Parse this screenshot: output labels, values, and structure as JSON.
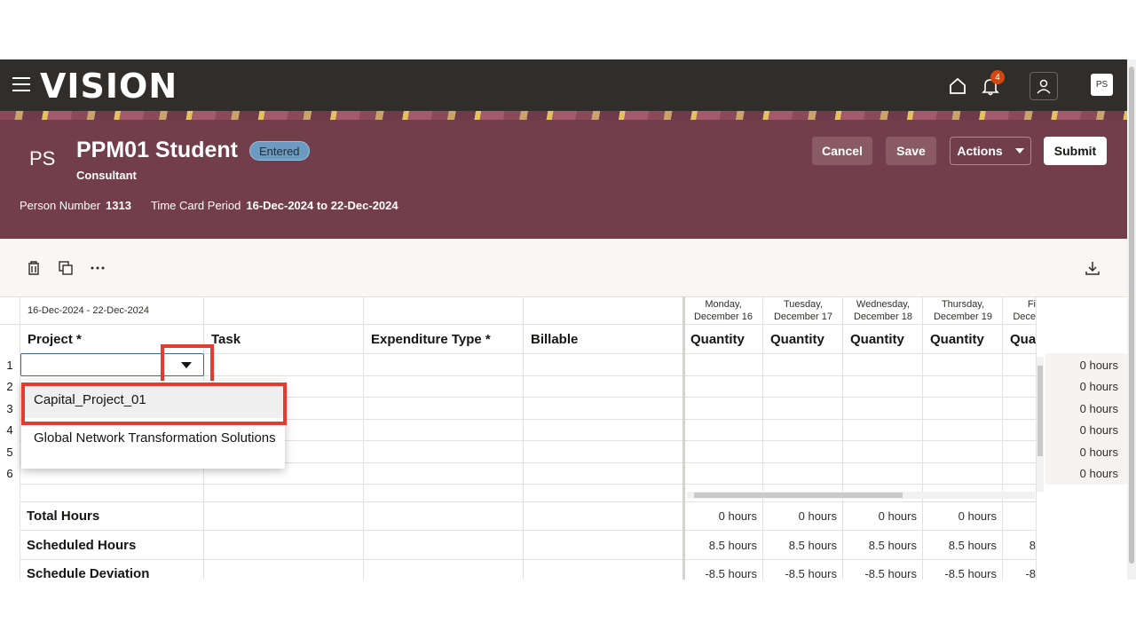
{
  "app": {
    "logo": "VISION",
    "notification_count": "4",
    "avatar_initials": "PS"
  },
  "person": {
    "initials": "PS",
    "name": "PPM01 Student",
    "status": "Entered",
    "role": "Consultant",
    "person_number_label": "Person Number",
    "person_number": "1313",
    "period_label": "Time Card Period",
    "period": "16-Dec-2024 to 22-Dec-2024"
  },
  "actions": {
    "cancel": "Cancel",
    "save": "Save",
    "actions": "Actions",
    "submit": "Submit"
  },
  "grid": {
    "range": "16-Dec-2024 - 22-Dec-2024",
    "columns": {
      "project": "Project *",
      "task": "Task",
      "expenditure": "Expenditure Type *",
      "billable": "Billable"
    },
    "days": [
      {
        "line1": "Monday,",
        "line2": "December 16",
        "qty": "Quantity"
      },
      {
        "line1": "Tuesday,",
        "line2": "December 17",
        "qty": "Quantity"
      },
      {
        "line1": "Wednesday,",
        "line2": "December 18",
        "qty": "Quantity"
      },
      {
        "line1": "Thursday,",
        "line2": "December 19",
        "qty": "Quantity"
      },
      {
        "line1": "Fi",
        "line2": "Dece",
        "qty": "Qua"
      }
    ],
    "rows": [
      {
        "num": "1",
        "hours": "0 hours"
      },
      {
        "num": "2",
        "hours": "0 hours"
      },
      {
        "num": "3",
        "hours": "0 hours"
      },
      {
        "num": "4",
        "hours": "0 hours"
      },
      {
        "num": "5",
        "hours": "0 hours"
      },
      {
        "num": "6",
        "hours": "0 hours"
      }
    ],
    "summary": {
      "total": {
        "label": "Total Hours",
        "values": [
          "0 hours",
          "0 hours",
          "0 hours",
          "0 hours"
        ]
      },
      "scheduled": {
        "label": "Scheduled Hours",
        "values": [
          "8.5 hours",
          "8.5 hours",
          "8.5 hours",
          "8.5 hours",
          "8"
        ]
      },
      "deviation": {
        "label": "Schedule Deviation",
        "values": [
          "-8.5 hours",
          "-8.5 hours",
          "-8.5 hours",
          "-8.5 hours",
          "-8"
        ]
      }
    }
  },
  "dropdown": {
    "options": [
      "Capital_Project_01",
      "Global Network Transformation Solutions"
    ]
  },
  "colors": {
    "header": "#733e4b",
    "topbar": "#312d2a",
    "highlight": "#e53b30",
    "status": "#6b9bc1"
  }
}
